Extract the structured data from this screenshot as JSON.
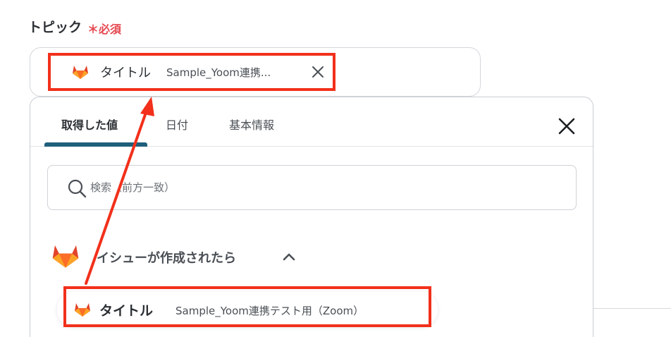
{
  "field": {
    "label": "トピック",
    "required_mark": "＊",
    "required_text": "必須"
  },
  "selected_chip": {
    "icon": "gitlab-icon",
    "title": "タイトル",
    "value": "Sample_Yoom連携..."
  },
  "picker": {
    "tabs": [
      {
        "label": "取得した値",
        "active": true
      },
      {
        "label": "日付",
        "active": false
      },
      {
        "label": "基本情報",
        "active": false
      }
    ],
    "search": {
      "placeholder": "検索（前方一致）",
      "value": ""
    },
    "group": {
      "icon": "gitlab-icon",
      "label": "イシューが作成されたら",
      "expanded": true
    },
    "items": [
      {
        "icon": "gitlab-icon",
        "title": "タイトル",
        "value": "Sample_Yoom連携テスト用（Zoom）"
      }
    ]
  },
  "colors": {
    "required": "#e5474f",
    "highlight": "#f2301b",
    "tab_underline": "#1f5f7a",
    "gitlab_orange": "#e2432a"
  }
}
